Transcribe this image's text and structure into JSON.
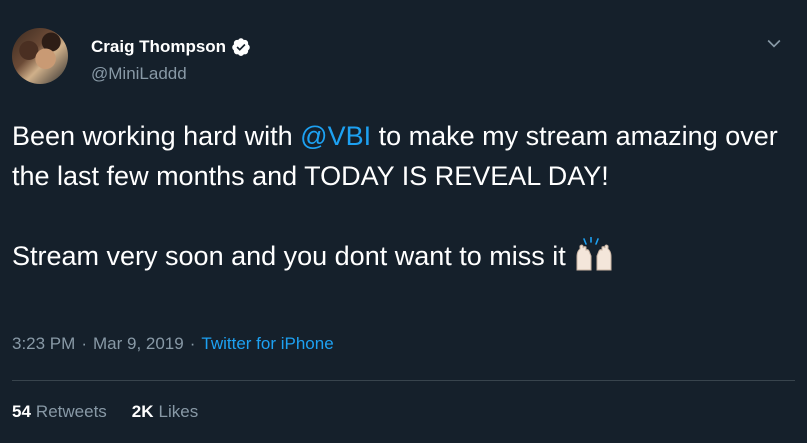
{
  "user": {
    "display_name": "Craig Thompson",
    "handle": "@MiniLaddd",
    "verified": true
  },
  "tweet": {
    "text_before_mention": "Been working hard with ",
    "mention": "@VBI",
    "text_after_mention": " to make my stream amazing over the last few months and TODAY IS REVEAL DAY!\n\nStream very soon and you dont want to miss it",
    "emoji": "raising-hands-icon"
  },
  "meta": {
    "time": "3:23 PM",
    "separator1": "·",
    "date": "Mar 9, 2019",
    "separator2": "·",
    "source": "Twitter for iPhone"
  },
  "stats": {
    "retweets_count": "54",
    "retweets_label": "Retweets",
    "likes_count": "2K",
    "likes_label": "Likes"
  },
  "colors": {
    "background": "#15202b",
    "accent": "#1da1f2",
    "secondary_text": "#8899a6",
    "divider": "#38444d"
  }
}
